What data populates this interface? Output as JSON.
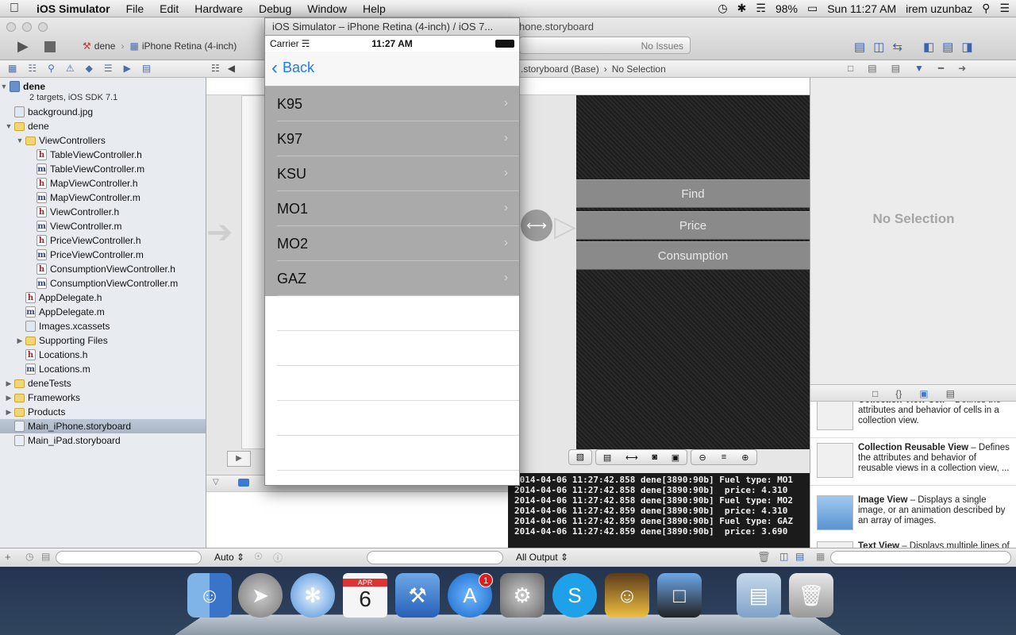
{
  "menubar": {
    "app": "iOS Simulator",
    "items": [
      "File",
      "Edit",
      "Hardware",
      "Debug",
      "Window",
      "Help"
    ],
    "battery": "98%",
    "clock": "Sun 11:27 AM",
    "user": "irem uzunbaz"
  },
  "xcode": {
    "window_title": "hone.storyboard",
    "scheme": "dene",
    "device": "iPhone Retina (4-inch)",
    "status": "No Issues",
    "breadcrumb": ".storyboard (Base)",
    "breadcrumb_selection": "No Selection",
    "console_filter": "All Output",
    "auto_label": "Auto"
  },
  "navigator": {
    "project": "dene",
    "project_sub": "2 targets, iOS SDK 7.1",
    "files": [
      {
        "name": "background.jpg",
        "type": "img",
        "indent": 1
      },
      {
        "name": "dene",
        "type": "folder",
        "indent": 1,
        "open": true
      },
      {
        "name": "ViewControllers",
        "type": "folder",
        "indent": 2,
        "open": true
      },
      {
        "name": "TableViewController.h",
        "type": "h",
        "indent": 3
      },
      {
        "name": "TableViewController.m",
        "type": "m",
        "indent": 3
      },
      {
        "name": "MapViewController.h",
        "type": "h",
        "indent": 3
      },
      {
        "name": "MapViewController.m",
        "type": "m",
        "indent": 3
      },
      {
        "name": "ViewController.h",
        "type": "h",
        "indent": 3
      },
      {
        "name": "ViewController.m",
        "type": "m",
        "indent": 3
      },
      {
        "name": "PriceViewController.h",
        "type": "h",
        "indent": 3
      },
      {
        "name": "PriceViewController.m",
        "type": "m",
        "indent": 3
      },
      {
        "name": "ConsumptionViewController.h",
        "type": "h",
        "indent": 3
      },
      {
        "name": "ConsumptionViewController.m",
        "type": "m",
        "indent": 3
      },
      {
        "name": "AppDelegate.h",
        "type": "h",
        "indent": 2
      },
      {
        "name": "AppDelegate.m",
        "type": "m",
        "indent": 2
      },
      {
        "name": "Images.xcassets",
        "type": "img",
        "indent": 2
      },
      {
        "name": "Supporting Files",
        "type": "folder",
        "indent": 2,
        "open": false
      },
      {
        "name": "Locations.h",
        "type": "h",
        "indent": 2
      },
      {
        "name": "Locations.m",
        "type": "m",
        "indent": 2
      },
      {
        "name": "deneTests",
        "type": "folder",
        "indent": 1,
        "open": false
      },
      {
        "name": "Frameworks",
        "type": "folder",
        "indent": 1,
        "open": false
      },
      {
        "name": "Products",
        "type": "folder",
        "indent": 1,
        "open": false
      },
      {
        "name": "Main_iPhone.storyboard",
        "type": "sb",
        "indent": 1,
        "selected": true
      },
      {
        "name": "Main_iPad.storyboard",
        "type": "sb",
        "indent": 1
      }
    ]
  },
  "scene_buttons": [
    "Find",
    "Price",
    "Consumption"
  ],
  "console": {
    "lines": [
      "2014-04-06 11:27:42.858 dene[3890:90b] Fuel type: MO1",
      "2014-04-06 11:27:42.858 dene[3890:90b]  price: 4.310",
      "2014-04-06 11:27:42.858 dene[3890:90b] Fuel type: MO2",
      "2014-04-06 11:27:42.859 dene[3890:90b]  price: 4.310",
      "2014-04-06 11:27:42.859 dene[3890:90b] Fuel type: GAZ",
      "2014-04-06 11:27:42.859 dene[3890:90b]  price: 3.690"
    ]
  },
  "inspector": {
    "no_selection": "No Selection",
    "library": [
      {
        "title": "Collection View Cell",
        "desc": " – Defines the attributes and behavior of cells in a collection view."
      },
      {
        "title": "Collection Reusable View",
        "desc": " – Defines the attributes and behavior of reusable views in a collection view, ..."
      },
      {
        "title": "Image View",
        "desc": " – Displays a single image, or an animation described by an array of images."
      },
      {
        "title": "Text View",
        "desc": " – Displays multiple lines of editable text and sends an action"
      }
    ]
  },
  "simulator": {
    "title": "iOS Simulator – iPhone Retina (4-inch) / iOS 7...",
    "carrier": "Carrier",
    "time": "11:27 AM",
    "back_label": "Back",
    "rows": [
      "K95",
      "K97",
      "KSU",
      "MO1",
      "MO2",
      "GAZ"
    ]
  },
  "dock": {
    "calendar_month": "APR",
    "calendar_day": "6",
    "appstore_badge": "1"
  }
}
